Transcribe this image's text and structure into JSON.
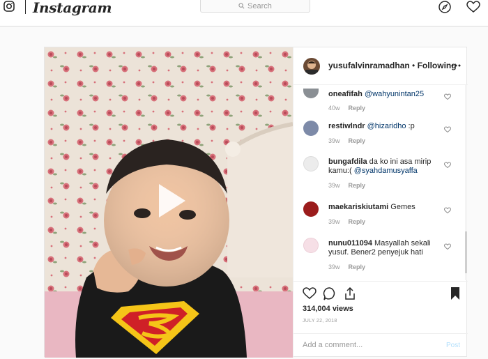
{
  "nav": {
    "brand": "Instagram",
    "search_placeholder": "Search",
    "icons": [
      "instagram-glyph-icon",
      "search-icon",
      "compass-icon",
      "heart-icon"
    ]
  },
  "post": {
    "author": "yusufalvinramadhan",
    "separator": "•",
    "follow_status": "Following",
    "comments": [
      {
        "user": "oneafifah",
        "text": "",
        "mention": "@wahyunintan25",
        "after": "",
        "age": "40w",
        "reply": "Reply",
        "avatar_color": "#8a8f94"
      },
      {
        "user": "restiwlndr",
        "text": "",
        "mention": "@hizaridho",
        "after": " :p",
        "age": "39w",
        "reply": "Reply",
        "avatar_color": "#7d8aa8"
      },
      {
        "user": "bungafdila",
        "text": " da ko ini asa mirip kamu:( ",
        "mention": "@syahdamusyaffa",
        "after": "",
        "age": "39w",
        "reply": "Reply",
        "avatar_color": "#e9e9e9"
      },
      {
        "user": "maekariskiutami",
        "text": " Gemes",
        "mention": "",
        "after": "",
        "age": "39w",
        "reply": "Reply",
        "avatar_color": "#9b1c1c"
      },
      {
        "user": "nunu011094",
        "text": " Masyallah sekali yusuf. Bener2 penyejuk hati",
        "mention": "",
        "after": "",
        "age": "39w",
        "reply": "Reply",
        "avatar_color": "#f6dfe6"
      }
    ],
    "views": "314,004 views",
    "date": "JULY 22, 2018",
    "add_comment_placeholder": "Add a comment...",
    "post_label": "Post"
  },
  "colors": {
    "link": "#003569",
    "muted": "#999999",
    "post_button": "#b2dffc",
    "border": "#dbdbdb"
  }
}
